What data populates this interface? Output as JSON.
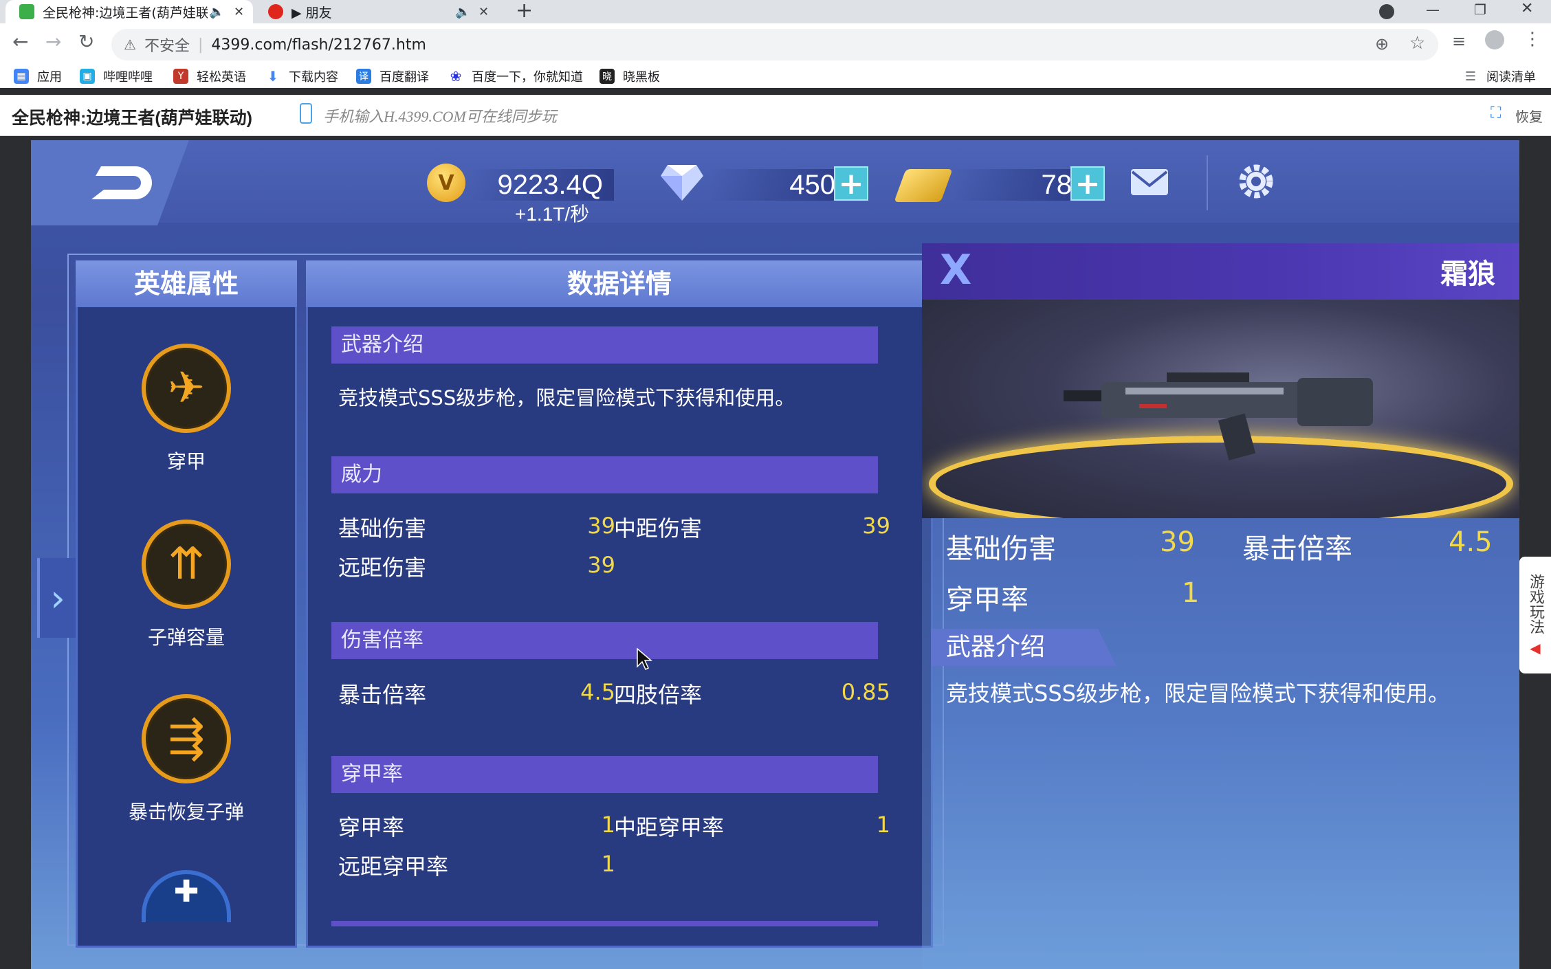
{
  "browser": {
    "tabs": [
      {
        "title": "全民枪神:边境王者(葫芦娃联",
        "active": true
      },
      {
        "title": "▶ 朋友",
        "active": false
      }
    ],
    "new_tab": "+",
    "security": "不安全",
    "url": "4399.com/flash/212767.htm",
    "bookmarks": [
      "应用",
      "哔哩哔哩",
      "轻松英语",
      "下载内容",
      "百度翻译",
      "百度一下，你就知道",
      "晓黑板"
    ],
    "reading_list": "阅读清单"
  },
  "page": {
    "game_title": "全民枪神:边境王者(葫芦娃联动)",
    "mobile_hint": "手机输入H.4399.COM可在线同步玩",
    "restore": "恢复"
  },
  "game": {
    "currency": {
      "gold": "9223.4Q",
      "gold_rate": "+1.1T/秒",
      "diamond": "450",
      "ticket": "78"
    },
    "left": {
      "title": "英雄属性",
      "skills": [
        {
          "label": "穿甲"
        },
        {
          "label": "子弹容量"
        },
        {
          "label": "暴击恢复子弹"
        }
      ]
    },
    "detail": {
      "title": "数据详情",
      "intro_header": "武器介绍",
      "intro_text": "竞技模式SSS级步枪，限定冒险模式下获得和使用。",
      "power_header": "威力",
      "power": {
        "base_label": "基础伤害",
        "base_value": "39",
        "mid_label": "中距伤害",
        "mid_value": "39",
        "far_label": "远距伤害",
        "far_value": "39"
      },
      "mult_header": "伤害倍率",
      "mult": {
        "crit_label": "暴击倍率",
        "crit_value": "4.5",
        "limb_label": "四肢倍率",
        "limb_value": "0.85"
      },
      "pen_header": "穿甲率",
      "pen": {
        "pen_label": "穿甲率",
        "pen_value": "1",
        "mid_label": "中距穿甲率",
        "mid_value": "1",
        "far_label": "远距穿甲率",
        "far_value": "1"
      }
    },
    "weapon": {
      "close": "X",
      "name": "霜狼",
      "base_label": "基础伤害",
      "base_value": "39",
      "crit_label": "暴击倍率",
      "crit_value": "4.5",
      "pen_label": "穿甲率",
      "pen_value": "1",
      "intro_header": "武器介绍",
      "intro_text": "竞技模式SSS级步枪，限定冒险模式下获得和使用。"
    },
    "side_tab": "游戏玩法"
  },
  "colors": {
    "accent_yellow": "#f2d94a",
    "section_purple": "#5e50c8",
    "panel_blue": "#283a80",
    "plus_cyan": "#4cc3d8"
  }
}
